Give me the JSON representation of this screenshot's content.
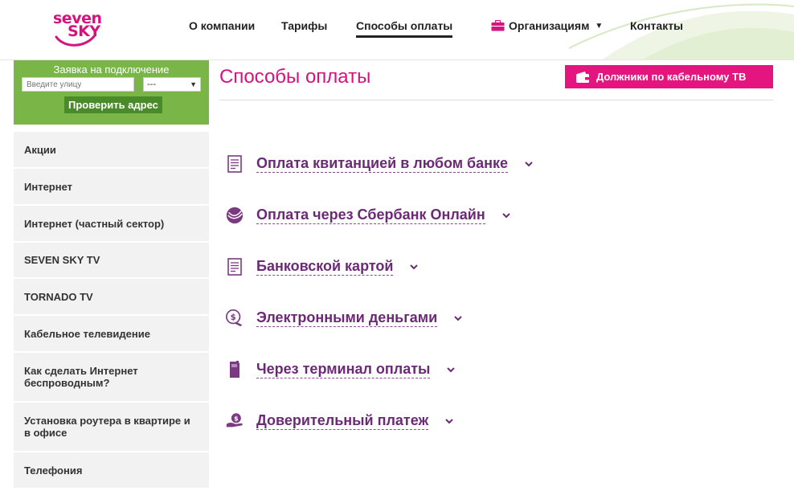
{
  "brand": {
    "logo_line1": "seven",
    "logo_line2": "SKY",
    "accent_color": "#d6127f",
    "green_color": "#7ab547"
  },
  "nav": {
    "items": [
      {
        "label": "О компании"
      },
      {
        "label": "Тарифы"
      },
      {
        "label": "Способы оплаты",
        "active": true
      },
      {
        "label": "Организациям",
        "icon": "briefcase-icon",
        "dropdown": true
      },
      {
        "label": "Контакты"
      }
    ]
  },
  "apply": {
    "title": "Заявка на подключение",
    "street_placeholder": "Введите улицу",
    "house_value": "---",
    "check_button": "Проверить адрес"
  },
  "sidebar": {
    "items": [
      {
        "label": "Акции"
      },
      {
        "label": "Интернет"
      },
      {
        "label": "Интернет (частный сектор)"
      },
      {
        "label": "SEVEN SKY TV"
      },
      {
        "label": "TORNADO TV"
      },
      {
        "label": "Кабельное телевидение"
      },
      {
        "label": "Как сделать Интернет беспроводным?"
      },
      {
        "label": "Установка роутера в квартире и в офисе"
      },
      {
        "label": "Телефония"
      }
    ]
  },
  "main": {
    "title": "Способы оплаты",
    "debtors_button": "Должники по кабельному ТВ",
    "payment_methods": [
      {
        "label": "Оплата квитанцией в любом банке",
        "icon": "receipt-icon"
      },
      {
        "label": "Оплата через Сбербанк Онлайн",
        "icon": "sberbank-icon"
      },
      {
        "label": "Банковской картой",
        "icon": "card-receipt-icon"
      },
      {
        "label": "Электронными деньгами",
        "icon": "e-money-icon"
      },
      {
        "label": "Через терминал оплаты",
        "icon": "terminal-icon"
      },
      {
        "label": "Доверительный платеж",
        "icon": "trust-payment-icon"
      }
    ]
  }
}
